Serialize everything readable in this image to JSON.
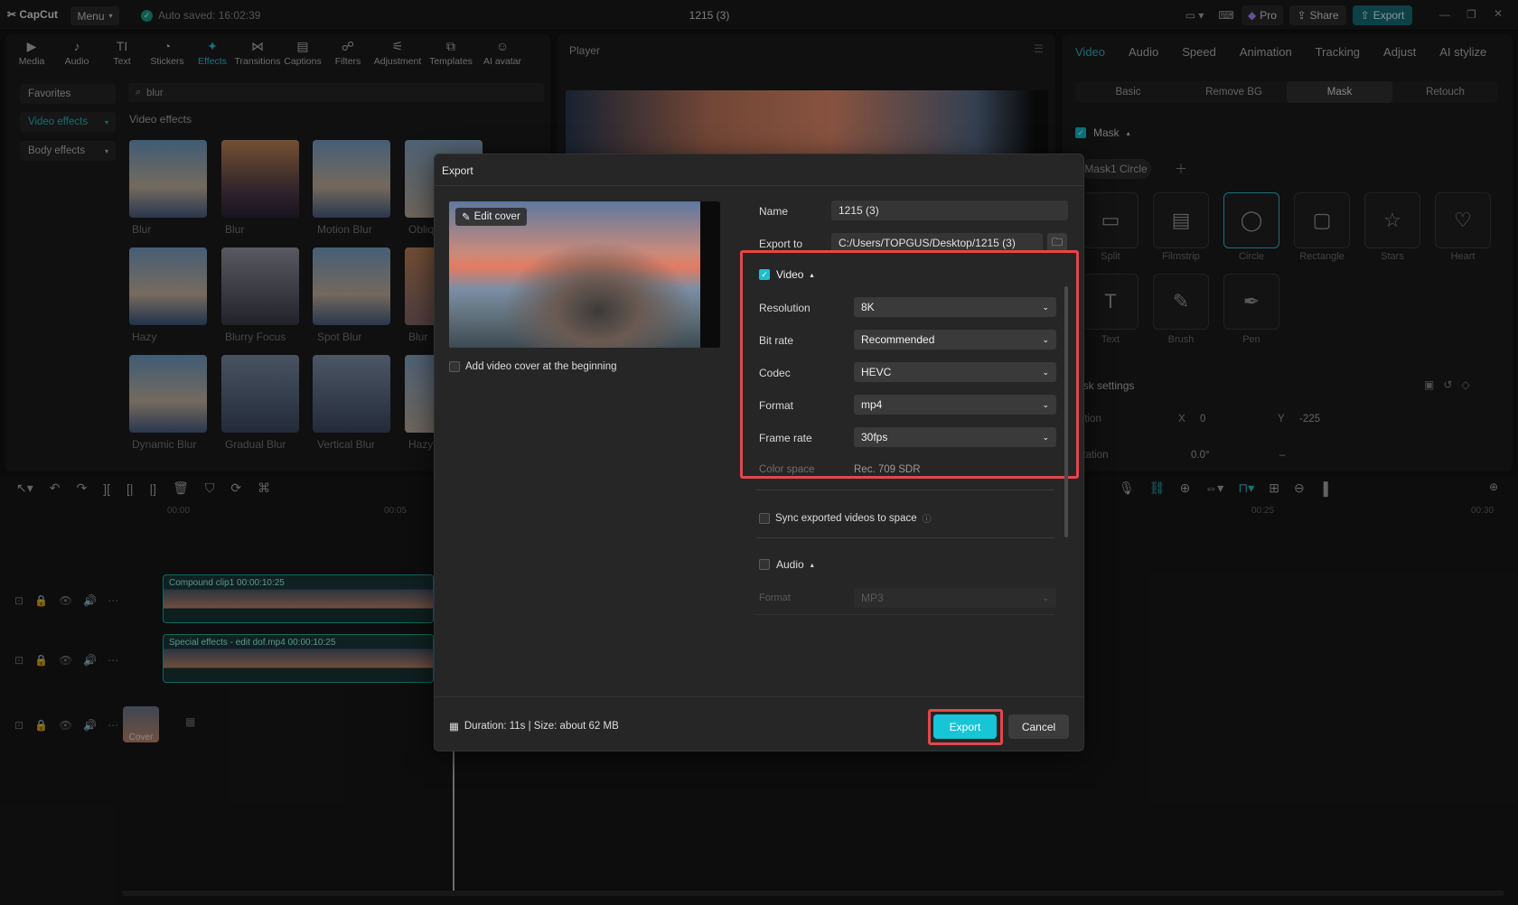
{
  "app": {
    "logo": "CapCut",
    "menu": "Menu",
    "autosave": "Auto saved: 16:02:39",
    "project_title": "1215 (3)",
    "pro": "Pro",
    "share": "Share",
    "export": "Export"
  },
  "toolbar": [
    "Media",
    "Audio",
    "Text",
    "Stickers",
    "Effects",
    "Transitions",
    "Captions",
    "Filters",
    "Adjustment",
    "Templates",
    "AI avatar"
  ],
  "left": {
    "categories": [
      "Favorites",
      "Video effects",
      "Body effects"
    ],
    "search_value": "blur",
    "section_title": "Video effects",
    "effects": [
      "Blur",
      "Blur",
      "Motion Blur",
      "Obliq",
      "Hazy",
      "Blurry Focus",
      "Spot Blur",
      "Blur",
      "Dynamic Blur",
      "Gradual Blur",
      "Vertical Blur",
      "Hazy"
    ]
  },
  "player": {
    "title": "Player"
  },
  "right": {
    "tabs": [
      "Video",
      "Audio",
      "Speed",
      "Animation",
      "Tracking",
      "Adjust",
      "AI stylize"
    ],
    "subtabs": [
      "Basic",
      "Remove BG",
      "Mask",
      "Retouch"
    ],
    "mask_label": "Mask",
    "mask_chip": "Mask1 Circle",
    "shapes": [
      "Split",
      "Filmstrip",
      "Circle",
      "Rectangle",
      "Stars",
      "Heart",
      "Text",
      "Brush",
      "Pen"
    ],
    "settings_label": "ask settings",
    "position_label": "sition",
    "x_label": "X",
    "x_value": "0",
    "y_label": "Y",
    "y_value": "-225",
    "rotation_label": "otation",
    "rotation_value": "0.0°",
    "rotation_extra": "–"
  },
  "timeline": {
    "ticks": [
      "00:00",
      "00:05",
      "00:25",
      "00:30"
    ],
    "clip1": "Compound clip1   00:00:10:25",
    "clip2": "Special effects - edit   dof.mp4   00:00:10:25",
    "cover": "Cover"
  },
  "dialog": {
    "title": "Export",
    "edit_cover": "Edit cover",
    "add_cover": "Add video cover at the beginning",
    "name_label": "Name",
    "name_value": "1215 (3)",
    "export_to_label": "Export to",
    "export_to_value": "C:/Users/TOPGUS/Desktop/1215 (3)",
    "video_label": "Video",
    "resolution_label": "Resolution",
    "resolution_value": "8K",
    "bitrate_label": "Bit rate",
    "bitrate_value": "Recommended",
    "codec_label": "Codec",
    "codec_value": "HEVC",
    "format_label": "Format",
    "format_value": "mp4",
    "framerate_label": "Frame rate",
    "framerate_value": "30fps",
    "colorspace_label": "Color space",
    "colorspace_value": "Rec. 709 SDR",
    "sync_label": "Sync exported videos to space",
    "audio_label": "Audio",
    "audio_format_label": "Format",
    "audio_format_value": "MP3",
    "footer_info": "Duration: 11s | Size: about 62 MB",
    "export_btn": "Export",
    "cancel_btn": "Cancel"
  }
}
